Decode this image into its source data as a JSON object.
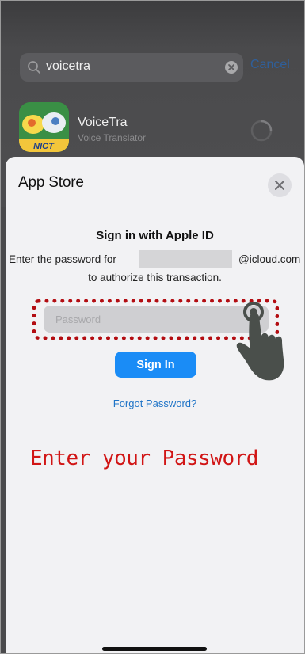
{
  "background": {
    "search": {
      "query": "voicetra",
      "cancel_label": "Cancel"
    },
    "app": {
      "name": "VoiceTra",
      "subtitle": "Voice Translator",
      "icon_label": "NICT"
    }
  },
  "sheet": {
    "title": "App Store",
    "heading": "Sign in with Apple ID",
    "prompt_prefix": "Enter the password for",
    "email_suffix": "@icloud.com",
    "prompt_line2": "to authorize this transaction.",
    "password_placeholder": "Password",
    "signin_label": "Sign In",
    "forgot_label": "Forgot Password?"
  },
  "annotation": {
    "instruction": "Enter your Password",
    "highlight_color": "#b30d12"
  },
  "colors": {
    "accent": "#1a8cf6",
    "link": "#1f74c7",
    "instruction": "#d11515"
  }
}
